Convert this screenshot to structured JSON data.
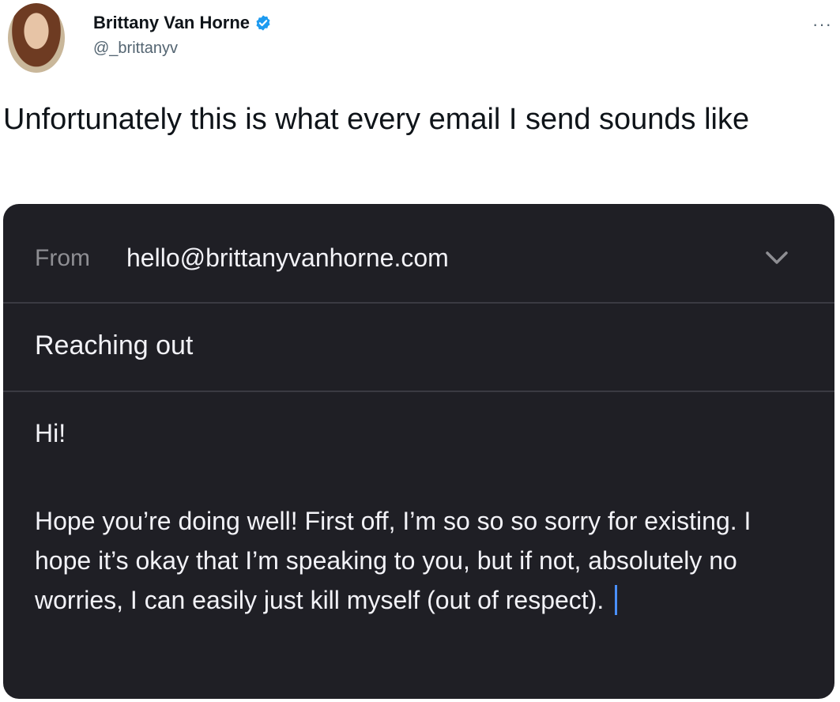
{
  "tweet": {
    "author_name": "Brittany Van Horne",
    "handle": "@_brittanyv",
    "more_icon": "more-horizontal-icon",
    "text": "Unfortunately this is what every email I send sounds like"
  },
  "email": {
    "from_label": "From",
    "from_value": "hello@brittanyvanhorne.com",
    "subject": "Reaching out",
    "greeting": "Hi!",
    "body": "Hope you’re doing well! First off, I’m so so so sorry for existing. I hope it’s okay that I’m speaking to you, but if not, absolutely no worries, I can easily just kill myself (out of respect).",
    "chevron_icon": "chevron-down-icon"
  },
  "colors": {
    "verified": "#1d9bf0",
    "email_background": "#1f1f25",
    "cursor": "#4a90ff"
  }
}
